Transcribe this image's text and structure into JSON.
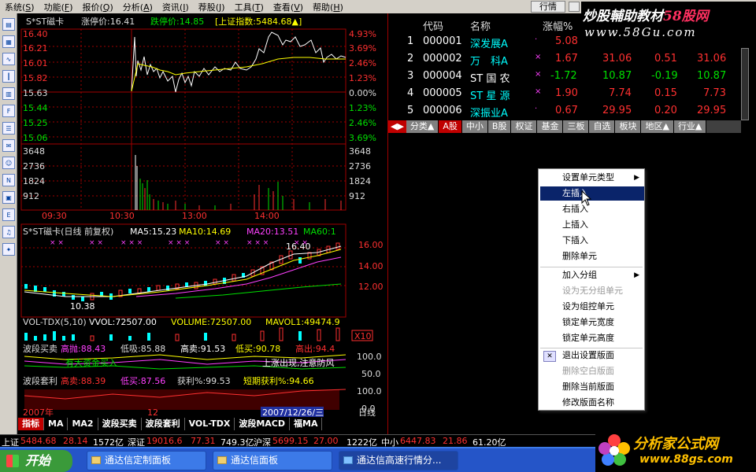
{
  "menu": [
    "系统(S)",
    "功能(F)",
    "报价(Q)",
    "分析(A)",
    "资讯(I)",
    "荐股(J)",
    "工具(T)",
    "查看(V)",
    "帮助(H)"
  ],
  "menu_keys": [
    "S",
    "F",
    "Q",
    "A",
    "I",
    "J",
    "T",
    "V",
    "H"
  ],
  "menu_names": [
    "系统",
    "功能",
    "报价",
    "分析",
    "资讯",
    "荐股",
    "工具",
    "查看",
    "帮助"
  ],
  "quote_button": "行情",
  "watermark_top": {
    "line1a": "炒股輔助教材",
    "line1b": "58股网",
    "line2": "www.58Gu.com"
  },
  "intraday": {
    "header_name": "S*ST磁卡",
    "limit_up": "涨停价:16.41",
    "limit_down": "跌停价:14.85",
    "index_label": "[上证指数:5484.68▲]",
    "price_left": [
      "16.40",
      "16.21",
      "16.01",
      "15.82",
      "15.63",
      "15.44",
      "15.25",
      "15.06"
    ],
    "pct_right": [
      "4.93%",
      "3.69%",
      "2.46%",
      "1.23%",
      "0.00%",
      "1.23%",
      "2.46%",
      "3.69%"
    ],
    "vol_left": [
      "3648",
      "2736",
      "1824",
      "912"
    ],
    "vol_right": [
      "3648",
      "2736",
      "1824",
      "912"
    ],
    "times": [
      "09:30",
      "10:30",
      "13:00",
      "14:00"
    ]
  },
  "kline": {
    "header": "S*ST磁卡(日线 前复权)",
    "ma5": "MA5:15.23",
    "ma10": "MA10:14.69",
    "ma20": "MA20:13.51",
    "ma60": "MA60:1",
    "y_right": [
      "16.00",
      "14.00",
      "12.00"
    ],
    "high_label": "16.40",
    "low_label": "10.38"
  },
  "vol_tdx": {
    "header": "VOL-TDX(5,10)",
    "vvol": "VVOL:72507.00",
    "volume": "VOLUME:72507.00",
    "mavol": "MAVOL1:49474.9",
    "scale": "X10"
  },
  "wave1": {
    "name": "波段买卖",
    "v1": "高抛:88.43",
    "v2": "低吸:85.88",
    "v3": "高卖:91.53",
    "v4": "低买:90.78",
    "v5": "高出:94.4",
    "y": [
      "100.0",
      "50.0"
    ],
    "note1": "有大资金买入",
    "note2": "上涨出现,注意防风"
  },
  "wave2": {
    "name": "波段套利",
    "v1": "高卖:88.39",
    "v2": "低买:87.56",
    "v3": "获利%:99.53",
    "v4": "短期获利%:94.66",
    "y": [
      "100.0",
      "0.0"
    ]
  },
  "date_axis": {
    "year": "2007年",
    "month": "12",
    "date": "2007/12/26/三",
    "period": "日线"
  },
  "bottom_tabs": [
    "指标",
    "MA",
    "MA2",
    "波段买卖",
    "波段套利",
    "VOL-TDX",
    "波段MACD",
    "福MA"
  ],
  "stock_table": {
    "headers": [
      "代码",
      "名称",
      "涨幅%"
    ],
    "rows": [
      {
        "n": "1",
        "code": "000001",
        "name": "深发展A",
        "pct": "5.08",
        "c4": "",
        "c5": "",
        "c6": ""
      },
      {
        "n": "2",
        "code": "000002",
        "name": "万　科A",
        "pct": "1.67",
        "c4": "31.06",
        "c5": "0.51",
        "c6": "31.06"
      },
      {
        "n": "3",
        "code": "000004",
        "name": "ST 国 农",
        "pct": "-1.72",
        "c4": "10.87",
        "c5": "-0.19",
        "c6": "10.87"
      },
      {
        "n": "4",
        "code": "000005",
        "name": "ST 星 源",
        "pct": "1.90",
        "c4": "7.74",
        "c5": "0.15",
        "c6": "7.73"
      },
      {
        "n": "5",
        "code": "000006",
        "name": "深振业A",
        "pct": "0.67",
        "c4": "29.95",
        "c5": "0.20",
        "c6": "29.95"
      }
    ]
  },
  "sector_tabs": [
    "分类▲",
    "A股",
    "中小",
    "B股",
    "权证",
    "基金",
    "三板",
    "自选",
    "板块",
    "地区▲",
    "行业▲"
  ],
  "context_menu": [
    "设置单元类型",
    "左插入",
    "右插入",
    "上插入",
    "下插入",
    "删除单元",
    "加入分组",
    "设为无分组单元",
    "设为组控单元",
    "锁定单元宽度",
    "锁定单元高度",
    "退出设置版面",
    "删除空白版面",
    "删除当前版面",
    "修改版面名称"
  ],
  "status": {
    "sh_name": "上证",
    "sh_val": "5484.68",
    "sh_chg": "28.14",
    "sh_amt": "1572亿",
    "sz_name": "深证",
    "sz_val": "19016.6",
    "sz_chg": "77.31",
    "sz_amt": "749.3亿",
    "hs_name": "沪深",
    "hs_val": "5699.15",
    "hs_chg": "27.00",
    "hs_amt": "1222亿",
    "zx_name": "中小",
    "zx_val": "6447.83",
    "zx_chg": "21.86",
    "zx_amt": "61.20亿"
  },
  "taskbar": {
    "start": "开始",
    "tasks": [
      "通达信定制面板",
      "通达信面板",
      "通达信高速行情分..."
    ]
  },
  "watermark_bottom": {
    "line1": "分析家公式网",
    "line2": "www.88gs.com"
  },
  "colors": {
    "red": "#ff3030",
    "green": "#00e000",
    "grid": "#a00000",
    "yellow": "#ffff00",
    "cyan": "#00ffff",
    "magenta": "#ff40ff"
  }
}
